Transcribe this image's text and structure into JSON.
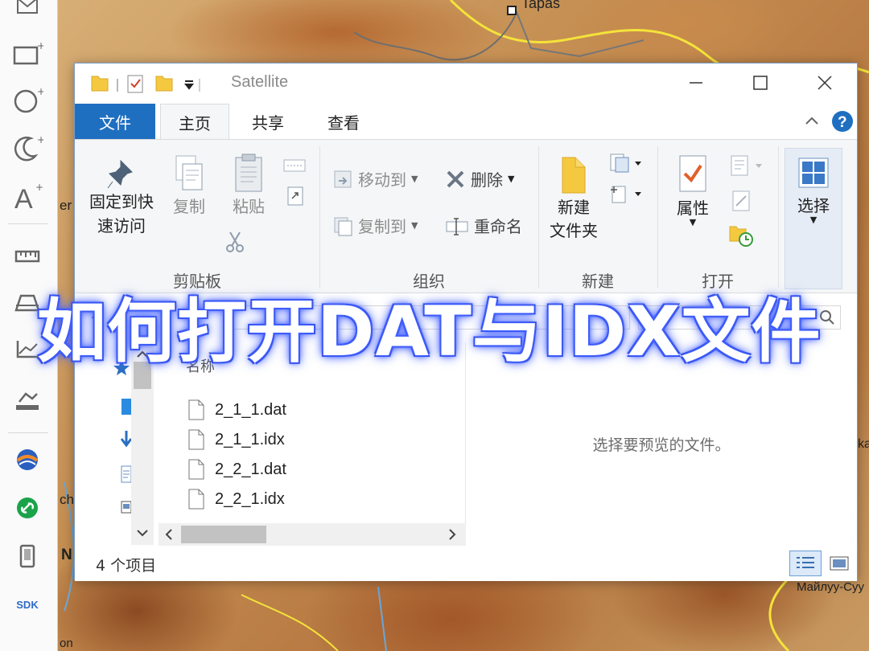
{
  "map": {
    "labels": {
      "top": "Tapas",
      "right_mid": "ka",
      "right_bottom": "Майлуу-Суу",
      "left_a": "er",
      "left_b": "ch",
      "left_c": "N",
      "left_d": "on"
    }
  },
  "left_toolbar": {
    "tools": [
      {
        "icon": "envelope-icon"
      },
      {
        "icon": "rectangle-add-icon"
      },
      {
        "icon": "circle-add-icon"
      },
      {
        "icon": "moon-add-icon"
      },
      {
        "icon": "text-add-icon",
        "glyph": "A"
      },
      {
        "icon": "ruler-icon"
      },
      {
        "icon": "area-measure-icon"
      },
      {
        "icon": "elevation-icon"
      },
      {
        "icon": "profile-icon"
      },
      {
        "icon": "globe-app-icon"
      },
      {
        "icon": "link-app-icon"
      },
      {
        "icon": "phone-icon"
      }
    ],
    "sdk_label": "SDK"
  },
  "window": {
    "title": "Satellite",
    "tabs": {
      "file": "文件",
      "home": "主页",
      "share": "共享",
      "view": "查看"
    },
    "ribbon": {
      "clipboard": {
        "pin_label": "固定到快\n速访问",
        "copy_label": "复制",
        "paste_label": "粘贴",
        "group_label": "剪贴板"
      },
      "organize": {
        "move_to": "移动到",
        "copy_to": "复制到",
        "delete": "删除",
        "rename": "重命名",
        "group_label": "组织"
      },
      "new": {
        "new_folder": "新建\n文件夹",
        "group_label": "新建"
      },
      "open": {
        "properties": "属性",
        "group_label": "打开"
      },
      "select": {
        "select_label": "选择"
      }
    },
    "column_header": "名称",
    "files": [
      {
        "name": "2_1_1.dat"
      },
      {
        "name": "2_1_1.idx"
      },
      {
        "name": "2_2_1.dat"
      },
      {
        "name": "2_2_1.idx"
      }
    ],
    "preview_text": "选择要预览的文件。",
    "status_text": "4 个项目"
  },
  "overlay_caption": "如何打开DAT与IDX文件",
  "colors": {
    "file_tab": "#1f6fc1",
    "caption_glow": "#3d5dff",
    "help": "#1f6fc1"
  }
}
